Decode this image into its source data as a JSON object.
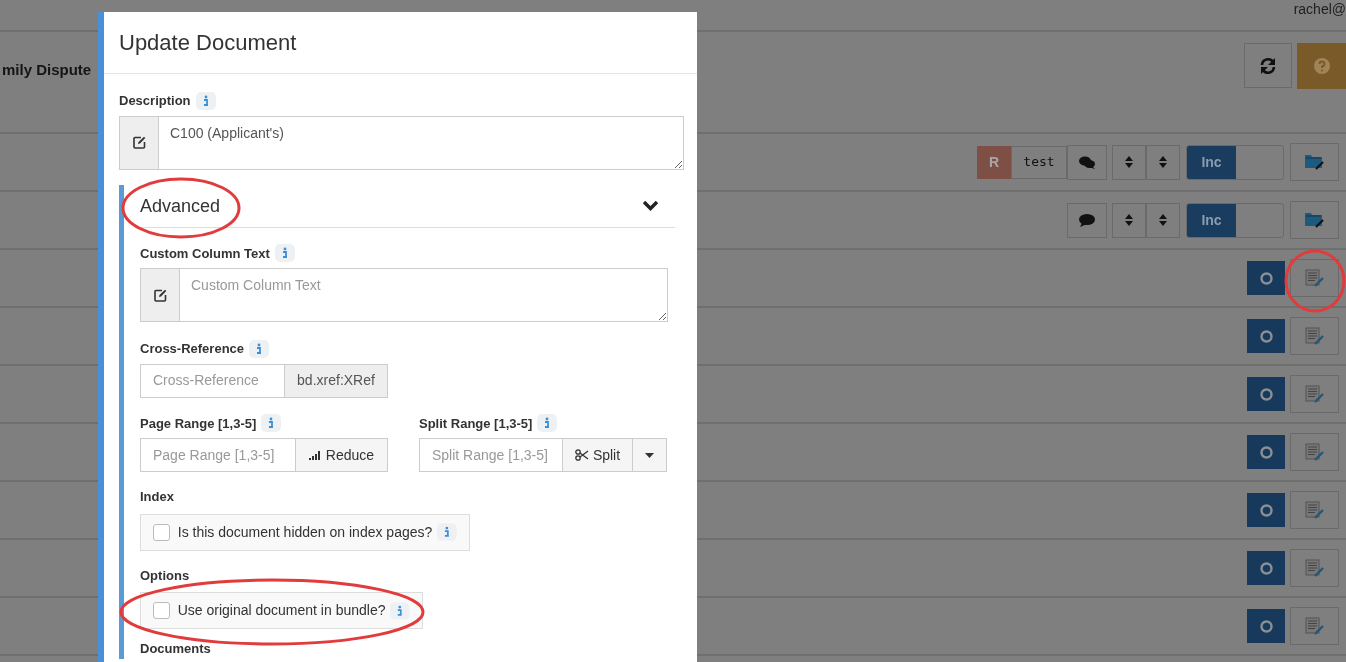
{
  "app": {
    "user": "rachel@",
    "heading": "mily Dispute"
  },
  "rows": [
    {
      "kind": "bundle",
      "badge": "R",
      "tag": "test",
      "comment_button": {
        "kind": "many"
      },
      "toggle": {
        "label": "Inc",
        "on": true
      }
    },
    {
      "kind": "bundle",
      "comment_button": {
        "kind": "one"
      },
      "toggle": {
        "label": "Inc",
        "on": true
      }
    },
    {
      "kind": "document"
    },
    {
      "kind": "document"
    },
    {
      "kind": "document"
    },
    {
      "kind": "document"
    },
    {
      "kind": "document"
    },
    {
      "kind": "document"
    },
    {
      "kind": "document"
    }
  ],
  "dialog": {
    "title": "Update Document",
    "description": {
      "label": "Description",
      "value": "C100 (Applicant's)"
    },
    "advanced": {
      "title": "Advanced",
      "expanded": true
    },
    "custom_column_text": {
      "label": "Custom Column Text",
      "placeholder": "Custom Column Text"
    },
    "cross_reference": {
      "label": "Cross-Reference",
      "placeholder": "Cross-Reference",
      "addon": "bd.xref:XRef"
    },
    "page_range": {
      "label": "Page Range [1,3-5]",
      "placeholder": "Page Range [1,3-5]",
      "button": "Reduce"
    },
    "split_range": {
      "label": "Split Range [1,3-5]",
      "placeholder": "Split Range [1,3-5]",
      "button": "Split"
    },
    "index": {
      "label": "Index",
      "checkbox": {
        "label": "Is this document hidden on index pages?",
        "checked": false
      }
    },
    "options": {
      "label": "Options",
      "checkbox": {
        "label": "Use original document in bundle?",
        "checked": false
      }
    },
    "documents": {
      "label": "Documents"
    }
  }
}
